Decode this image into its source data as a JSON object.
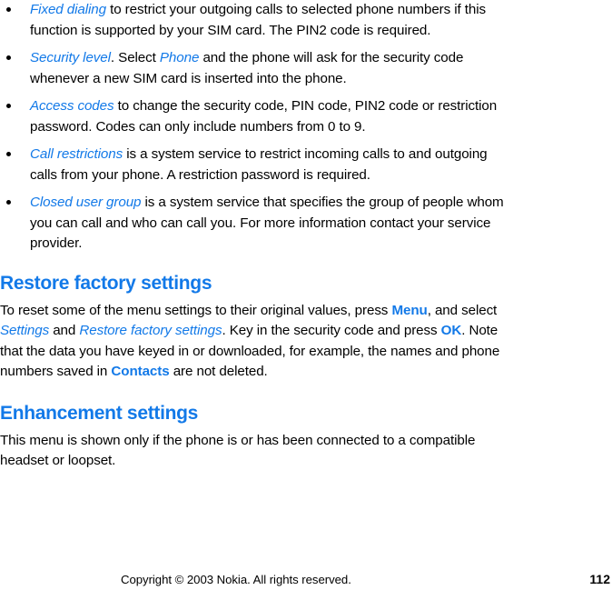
{
  "document": {
    "title": "Nokia phone user guide page",
    "page_number": "112",
    "accent_color": "#1279e8",
    "text_color": "#000000",
    "background_color": "#ffffff"
  },
  "bullets": [
    {
      "term": "Fixed dialing",
      "rest": " to restrict your outgoing calls to selected phone numbers if this function is supported by your SIM card. The PIN2 code is required."
    },
    {
      "term": "Security level",
      "mid": ". Select ",
      "term2": "Phone",
      "rest": " and the phone will ask for the security code whenever a new SIM card is inserted into the phone."
    },
    {
      "term": "Access codes",
      "rest": " to change the security code, PIN code, PIN2 code or restriction password. Codes can only include numbers from 0 to 9."
    },
    {
      "term": "Call restrictions",
      "rest": " is a system service to restrict incoming calls to and outgoing calls from your phone. A restriction password is required."
    },
    {
      "term": "Closed user group",
      "rest": " is a system service that specifies the group of people whom you can call and who can call you. For more information contact your service provider."
    }
  ],
  "sections": [
    {
      "heading": "Restore factory settings",
      "paragraph": {
        "p1": "To reset some of the menu settings to their original values, press ",
        "menu_label": "Menu",
        "p2": ", and select ",
        "settings_label": "Settings",
        "p3": " and ",
        "restore_label": "Restore factory settings",
        "p4": ". Key in the security code and press ",
        "ok_label": "OK",
        "p5": ". Note that the data you have keyed in or downloaded, for example, the names and phone numbers saved in ",
        "contacts_label": "Contacts",
        "p6": " are not deleted."
      }
    },
    {
      "heading": "Enhancement settings",
      "paragraph": {
        "p1": "This menu is shown only if the phone is or has been connected to a compatible headset or loopset."
      }
    }
  ],
  "footer": {
    "copyright": "Copyright © 2003 Nokia. All rights reserved.",
    "page_number": "112"
  }
}
